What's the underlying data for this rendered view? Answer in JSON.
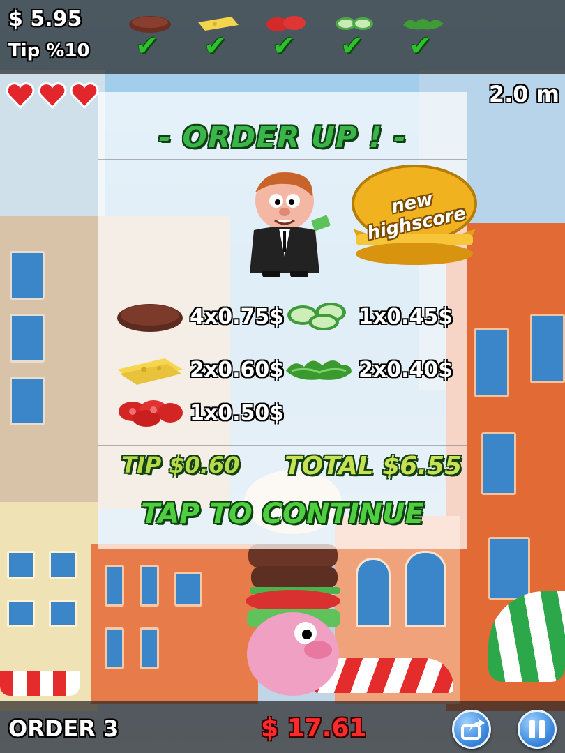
{
  "hud": {
    "money": "$ 5.95",
    "tip_percent": "Tip %10",
    "distance": "2.0 m",
    "lives": 3,
    "order_ingredients": [
      {
        "icon": "patty-icon",
        "checked": true
      },
      {
        "icon": "cheese-icon",
        "checked": true
      },
      {
        "icon": "tomato-icon",
        "checked": true
      },
      {
        "icon": "cucumber-icon",
        "checked": true
      },
      {
        "icon": "lettuce-icon",
        "checked": true
      }
    ]
  },
  "panel": {
    "title": "- ORDER UP ! -",
    "badge_text": "new highscore",
    "items": [
      {
        "icon": "patty-icon",
        "text": "4x0.75$"
      },
      {
        "icon": "cucumber-icon",
        "text": "1x0.45$"
      },
      {
        "icon": "cheese-icon",
        "text": "2x0.60$"
      },
      {
        "icon": "lettuce-icon",
        "text": "2x0.40$"
      },
      {
        "icon": "tomato-icon",
        "text": "1x0.50$"
      }
    ],
    "tip": "TIP $0.60",
    "total": "TOTAL $6.55",
    "continue": "TAP TO CONTINUE"
  },
  "bottom": {
    "order_label": "ORDER 3",
    "bank": "$ 17.61"
  },
  "colors": {
    "title_green": "#39b54a",
    "bank_red": "#ff2a2a",
    "check_green": "#2ec02e"
  }
}
